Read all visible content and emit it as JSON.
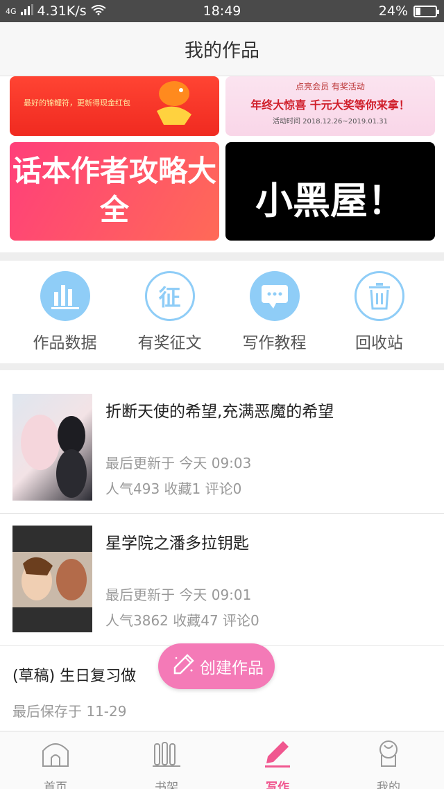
{
  "status_bar": {
    "network_label": "4G",
    "speed": "4.31K/s",
    "time": "18:49",
    "battery": "24%",
    "battery_level": 0.24
  },
  "header": {
    "title": "我的作品"
  },
  "banners": {
    "b1_small_text": "最好的锦鲤符，更新得现金红包",
    "b2_title": "点亮会员 有奖活动",
    "b2_sub": "年终大惊喜 千元大奖等你来拿！",
    "b2_date": "活动时间 2018.12.26~2019.01.31",
    "b3_text": "话本作者攻略大全",
    "b4_text": "小黑屋！"
  },
  "quick_actions": [
    {
      "label": "作品数据",
      "icon": "bar-chart-icon"
    },
    {
      "label": "有奖征文",
      "icon": "contest-icon",
      "glyph": "征"
    },
    {
      "label": "写作教程",
      "icon": "chat-bubble-icon"
    },
    {
      "label": "回收站",
      "icon": "trash-icon"
    }
  ],
  "works": [
    {
      "title": "折断天使的希望,充满恶魔的希望",
      "updated": "最后更新于 今天 09:03",
      "stats": "人气493 收藏1 评论0"
    },
    {
      "title": "星学院之潘多拉钥匙",
      "updated": "最后更新于 今天 09:01",
      "stats": "人气3862 收藏47 评论0"
    }
  ],
  "draft": {
    "title": "(草稿) 生日复习做",
    "saved": "最后保存于 11-29"
  },
  "fab": {
    "label": "创建作品",
    "icon": "pencil-icon"
  },
  "bottom_nav": [
    {
      "label": "首页",
      "icon": "home-icon"
    },
    {
      "label": "书架",
      "icon": "bookshelf-icon"
    },
    {
      "label": "写作",
      "icon": "write-icon",
      "active": true
    },
    {
      "label": "我的",
      "icon": "profile-icon"
    }
  ],
  "colors": {
    "accent_pink": "#f47ab7",
    "nav_active": "#f0578f",
    "icon_blue": "#8fcdf7"
  }
}
